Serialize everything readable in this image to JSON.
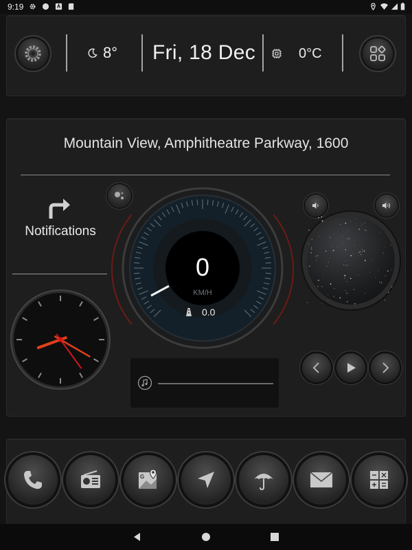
{
  "status_bar": {
    "time": "9:19",
    "icons": [
      "settings-icon",
      "circle-icon",
      "app-icon",
      "sd-card-icon",
      "location-icon",
      "wifi-icon",
      "signal-icon",
      "battery-icon"
    ]
  },
  "top": {
    "settings_icon": "settings-icon",
    "weather_icon": "moon-icon",
    "temperature": "8°",
    "date": "Fri, 18 Dec",
    "cpu_icon": "chip-icon",
    "cpu_temp": "0°C",
    "apps_icon": "apps-grid-icon"
  },
  "main": {
    "address": "Mountain View, Amphitheatre Parkway, 1600",
    "notifications_label": "Notifications",
    "speed": "0",
    "speed_unit": "KM/H",
    "odometer": "0.0",
    "music_progress": 0
  },
  "clock": {
    "hour": 8,
    "minute": 20,
    "second": 24
  },
  "dock": [
    {
      "name": "phone",
      "icon": "phone-icon"
    },
    {
      "name": "radio",
      "icon": "radio-icon"
    },
    {
      "name": "maps",
      "icon": "maps-icon"
    },
    {
      "name": "navigation",
      "icon": "navigation-arrow-icon"
    },
    {
      "name": "weather",
      "icon": "umbrella-icon"
    },
    {
      "name": "mail",
      "icon": "mail-icon"
    },
    {
      "name": "calculator",
      "icon": "calculator-icon"
    }
  ],
  "colors": {
    "accent": "#e0401a",
    "clock_second": "#d4151c",
    "background": "#141414"
  }
}
